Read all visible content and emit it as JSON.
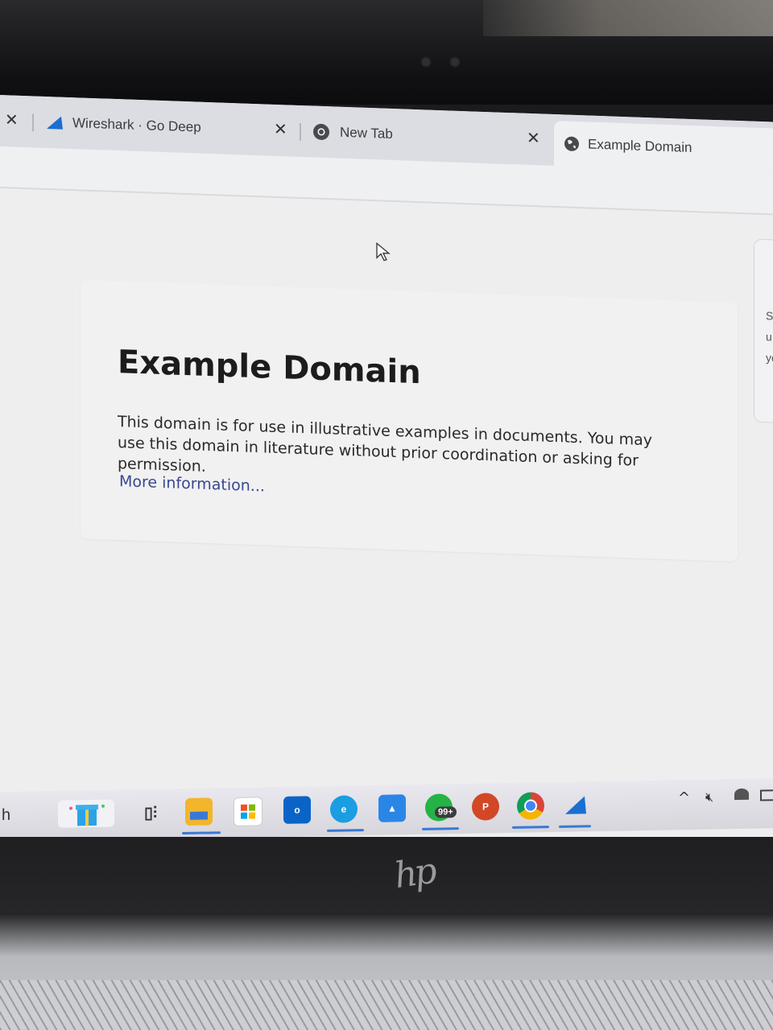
{
  "tabs": [
    {
      "label": "Wireshark · Go Deep",
      "icon": "wireshark-fin-icon",
      "active": false
    },
    {
      "label": "New Tab",
      "icon": "chrome-icon",
      "active": false
    },
    {
      "label": "Example Domain",
      "icon": "globe-icon",
      "active": true
    }
  ],
  "page": {
    "heading": "Example Domain",
    "paragraph": "This domain is for use in illustrative examples in documents. You may use this domain in literature without prior coordination or asking for permission.",
    "link": "More information..."
  },
  "side_panel": {
    "lines": [
      "S",
      "u",
      "yc"
    ]
  },
  "taskbar": {
    "search_fragment": "h",
    "whatsapp_badge": "99+",
    "items": [
      "gift-widget-icon",
      "task-view-icon",
      "file-explorer-icon",
      "microsoft-store-icon",
      "outlook-icon",
      "edge-icon",
      "photos-icon",
      "whatsapp-icon",
      "powerpoint-icon",
      "chrome-icon",
      "wireshark-icon"
    ],
    "tray": [
      "chevron-up-icon",
      "speaker-muted-icon",
      "network-icon",
      "battery-icon"
    ]
  },
  "colors": {
    "link": "#38488f",
    "heading": "#1c1c1c",
    "taskbar_accent": "#3a78d6"
  },
  "device_logo": "hp"
}
